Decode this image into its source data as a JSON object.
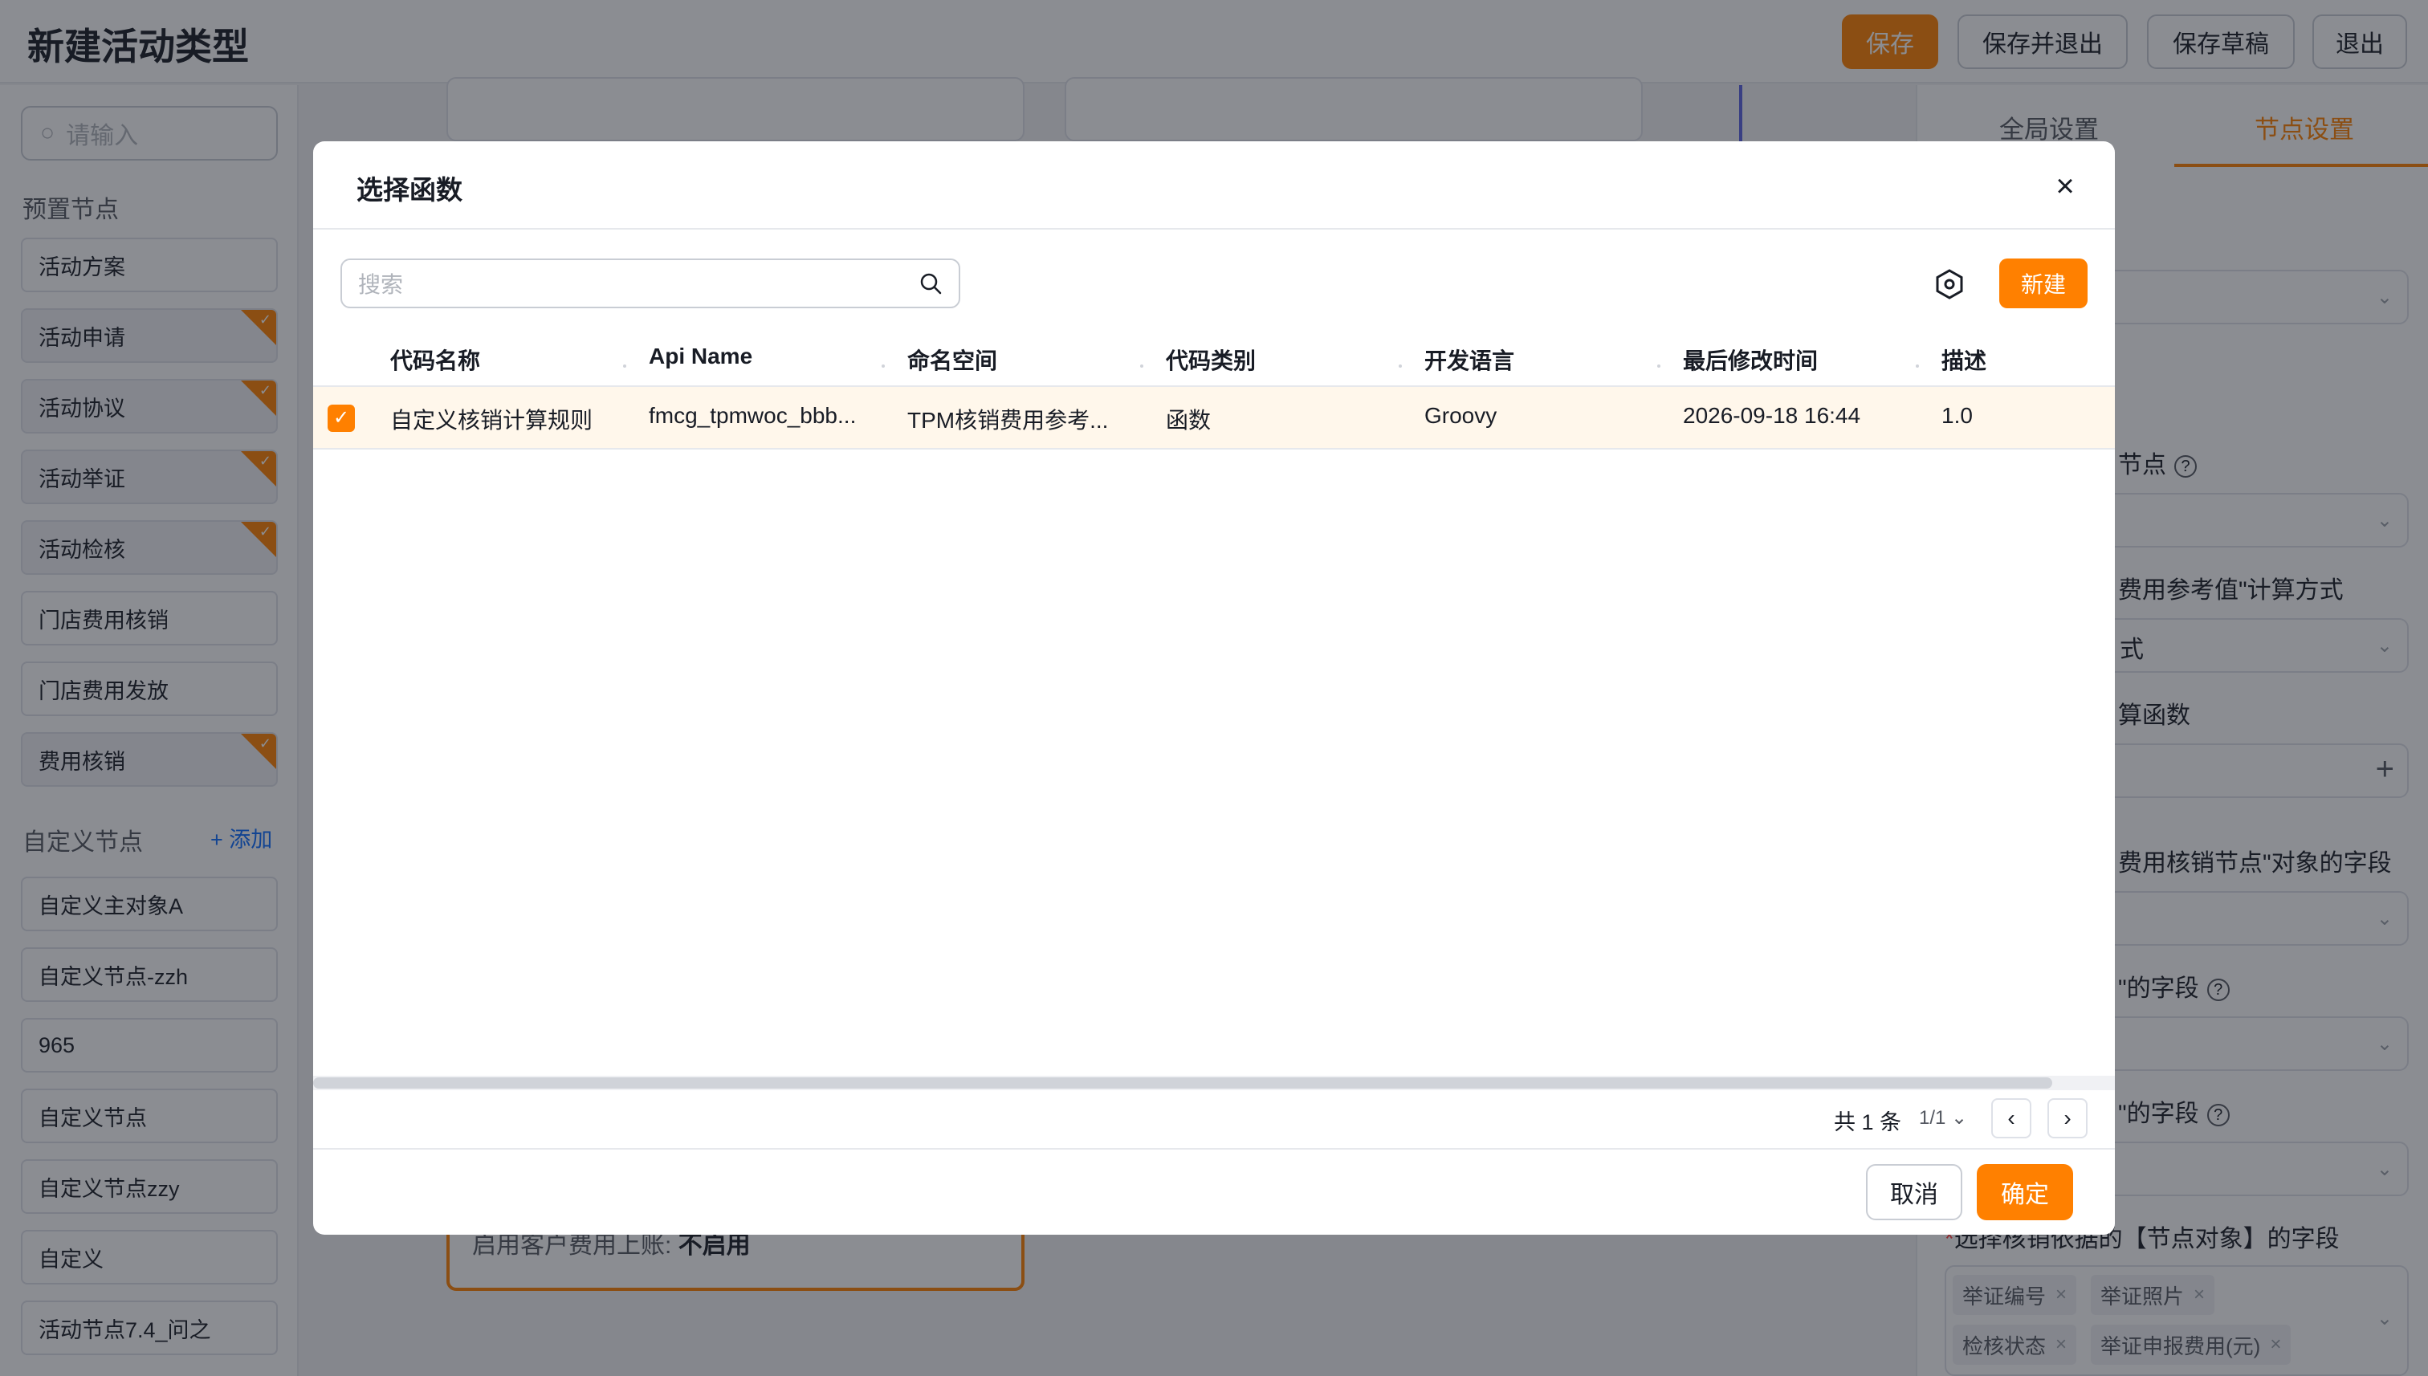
{
  "header": {
    "title": "新建活动类型",
    "buttons": {
      "save": "保存",
      "save_exit": "保存并退出",
      "save_draft": "保存草稿",
      "exit": "退出"
    }
  },
  "left_panel": {
    "search_placeholder": "请输入",
    "preset_title": "预置节点",
    "preset_nodes": [
      "活动方案",
      "活动申请",
      "活动协议",
      "活动举证",
      "活动检核",
      "门店费用核销",
      "门店费用发放",
      "费用核销"
    ],
    "custom_title": "自定义节点",
    "add_label": "+ 添加",
    "custom_nodes": [
      "自定义主对象A",
      "自定义节点-zzh",
      "965",
      "自定义节点",
      "自定义节点zzy",
      "自定义",
      "活动节点7.4_问之"
    ]
  },
  "canvas": {
    "card_text_label": "启用客户费用上账:",
    "card_text_value": "不启用"
  },
  "right_panel": {
    "tabs": [
      "全局设置",
      "节点设置"
    ],
    "labels": [
      "节点",
      "费用参考值\"计算方式",
      "算函数",
      "费用核销节点\"对象的字段",
      "\"的字段",
      "\"的字段"
    ],
    "select_partial": "式",
    "final_label": "选择核销依据的【节点对象】的字段",
    "required_mark": "*",
    "tags": [
      "举证编号",
      "举证照片",
      "检核状态",
      "举证申报费用(元)"
    ]
  },
  "modal": {
    "title": "选择函数",
    "search_placeholder": "搜索",
    "new_button": "新建",
    "columns": [
      "代码名称",
      "Api Name",
      "命名空间",
      "代码类别",
      "开发语言",
      "最后修改时间",
      "描述"
    ],
    "rows": [
      {
        "selected": true,
        "name": "自定义核销计算规则",
        "api_name": "fmcg_tpmwoc_bbb...",
        "namespace": "TPM核销费用参考...",
        "category": "函数",
        "language": "Groovy",
        "modified": "2026-09-18 16:44",
        "description": "1.0"
      }
    ],
    "pager": {
      "total": "共 1 条",
      "page": "1/1",
      "prev": "‹",
      "next": "›"
    },
    "cancel": "取消",
    "confirm": "确定"
  },
  "colors": {
    "accent": "#ff8000",
    "link": "#0c6cff",
    "selected_row": "#fff7eb"
  }
}
